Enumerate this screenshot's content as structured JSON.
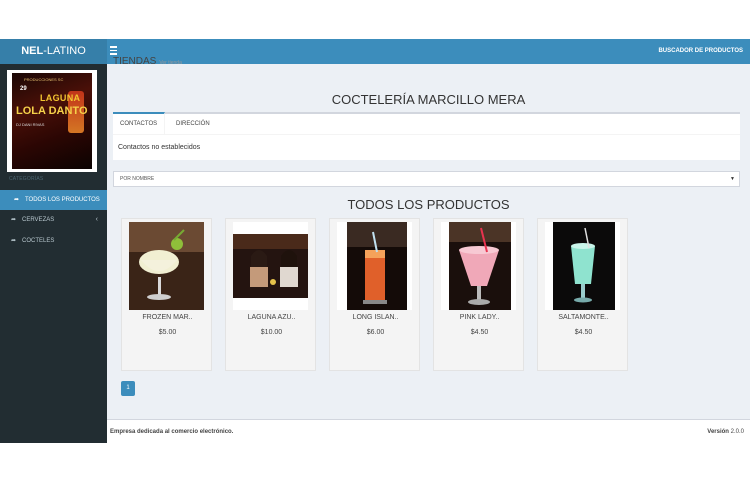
{
  "header": {
    "logo_bold": "NEL",
    "logo_rest": "-LATINO",
    "search_link": "BUSCADOR DE PRODUCTOS"
  },
  "sidebar": {
    "poster": {
      "line1": "PRODUCCIONES SC",
      "line2": "29",
      "line3": "LAGUNA",
      "line4": "LOLA DANTO",
      "line5": "DJ DANI RIVAS"
    },
    "header": "CATEGORÍAS",
    "items": [
      {
        "label": "TODOS LOS PRODUCTOS",
        "icon": "share-icon",
        "active": true
      },
      {
        "label": "CERVEZAS",
        "icon": "share-icon",
        "has_children": true
      },
      {
        "label": "COCTELES",
        "icon": "share-icon"
      }
    ]
  },
  "page": {
    "crumb_title": "TIENDAS",
    "crumb_sub": "Ver tienda",
    "store_title": "COCTELERÍA MARCILLO MERA",
    "tabs": [
      {
        "label": "CONTACTOS",
        "active": true
      },
      {
        "label": "DIRECCIÓN"
      }
    ],
    "tab_content": "Contactos no establecidos",
    "sort_select": "POR NOMBRE",
    "products_title": "TODOS LOS PRODUCTOS",
    "products": [
      {
        "name": "FROZEN MAR..",
        "price": "$5.00",
        "image": "frozen-drink"
      },
      {
        "name": "LAGUNA AZU..",
        "price": "$10.00",
        "image": "people-bar"
      },
      {
        "name": "LONG ISLAN..",
        "price": "$6.00",
        "image": "long-island-glass"
      },
      {
        "name": "PINK LADY..",
        "price": "$4.50",
        "image": "pink-cocktail"
      },
      {
        "name": "SALTAMONTE..",
        "price": "$4.50",
        "image": "green-cocktail"
      }
    ],
    "pagination": [
      "1"
    ]
  },
  "footer": {
    "left": "Empresa dedicada al comercio electrónico.",
    "version_label": "Versión",
    "version": "2.0.0"
  },
  "colors": {
    "accent": "#3c8dbc",
    "logo_bg": "#367fa9",
    "sidebar": "#222d32",
    "content_bg": "#ecf0f5"
  }
}
